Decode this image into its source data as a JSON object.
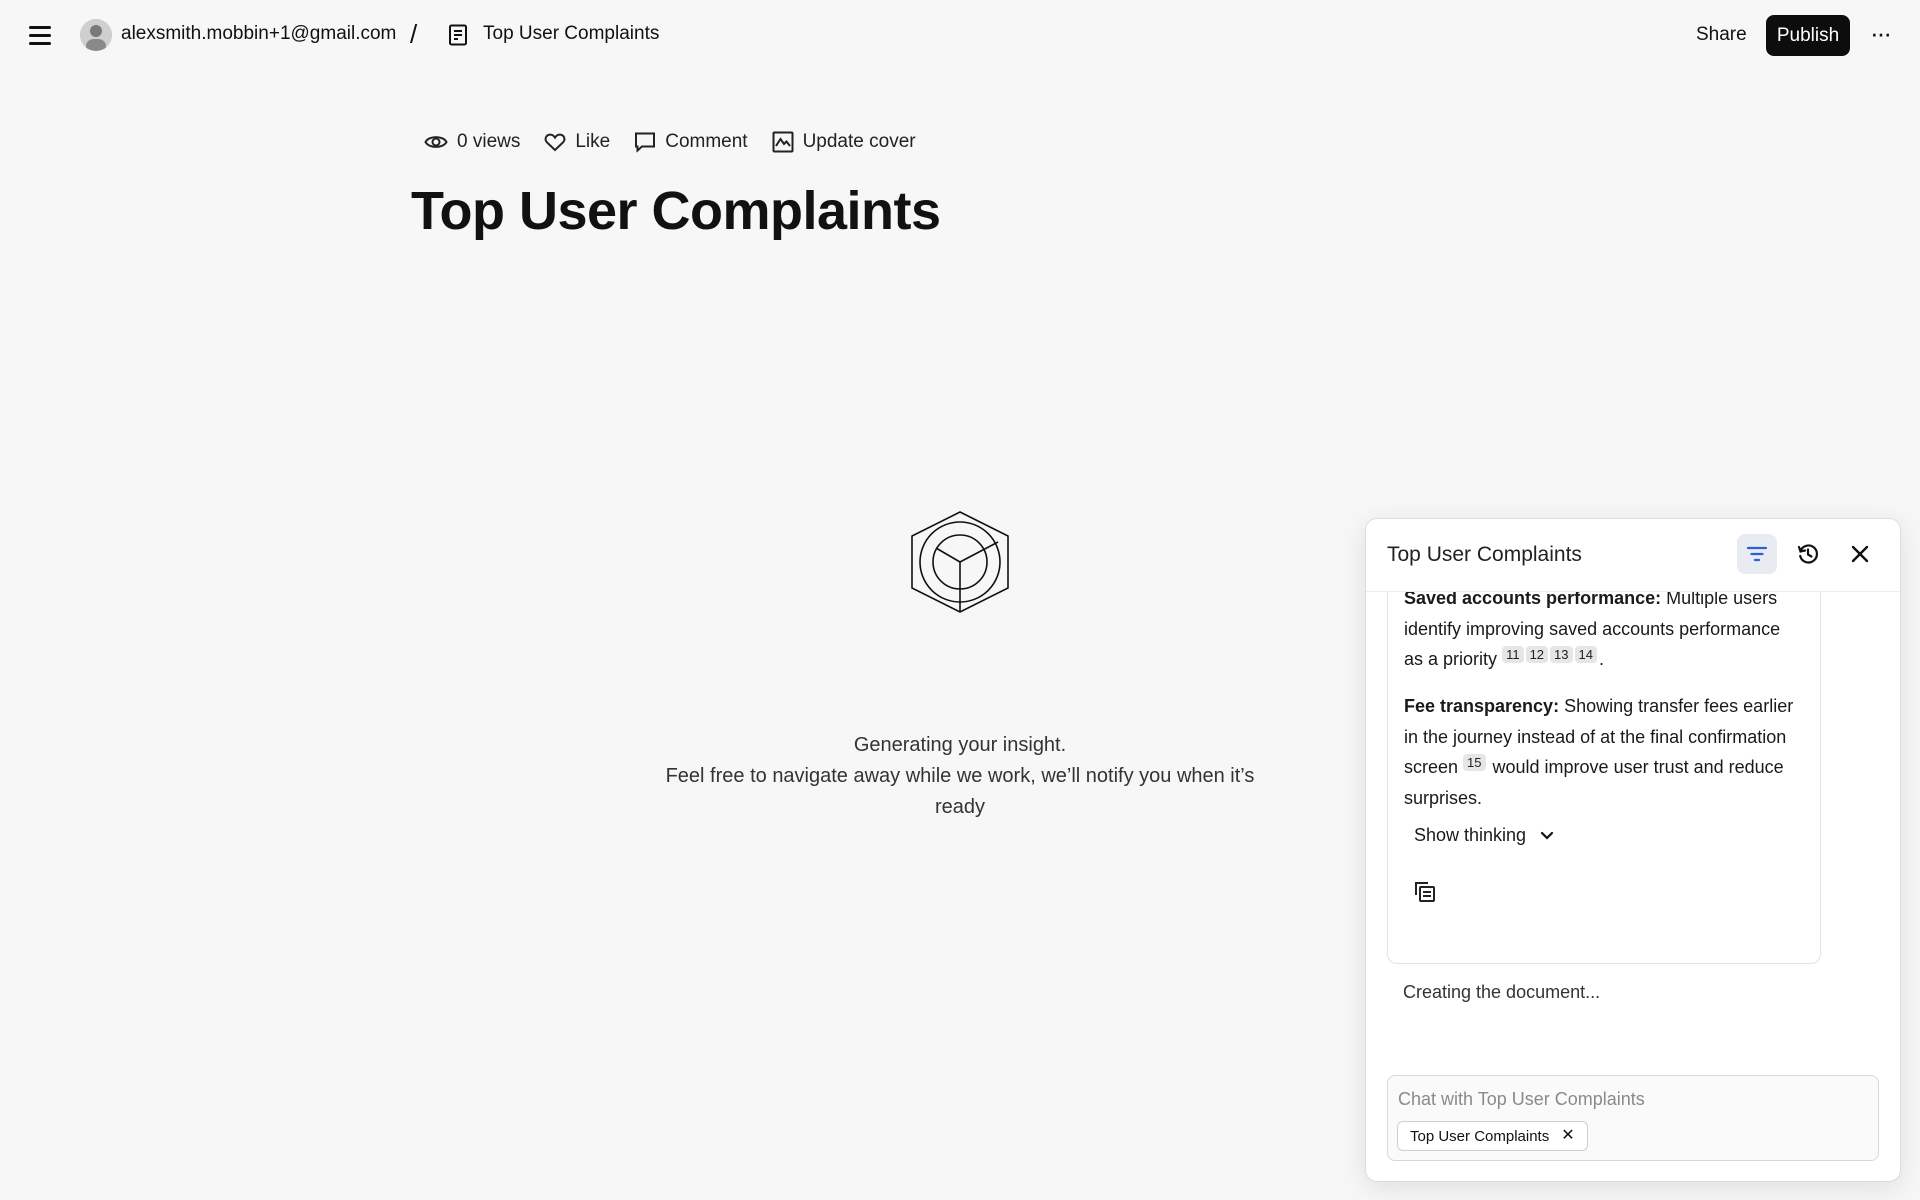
{
  "topbar": {
    "account_email": "alexsmith.mobbin+1@gmail.com",
    "separator": "/",
    "breadcrumb_title": "Top User Complaints",
    "share_label": "Share",
    "publish_label": "Publish",
    "more_label": "···"
  },
  "doc_actions": {
    "views_label": "0 views",
    "like_label": "Like",
    "comment_label": "Comment",
    "update_cover_label": "Update cover"
  },
  "page": {
    "title": "Top User Complaints"
  },
  "generating": {
    "line1": "Generating your insight.",
    "line2": "Feel free to navigate away while we work, we’ll notify you when it’s ready"
  },
  "chat": {
    "title": "Top User Complaints",
    "para1": {
      "bold": "Saved accounts performance:",
      "text": " Multiple users identify improving saved accounts performance as a priority",
      "citations": [
        "11",
        "12",
        "13",
        "14"
      ],
      "end": "."
    },
    "para2": {
      "bold": "Fee transparency:",
      "text_before": " Showing transfer fees earlier in the journey instead of at the final confirmation screen",
      "citation": "15",
      "text_after": " would improve user trust and reduce surprises."
    },
    "show_thinking_label": "Show thinking",
    "status": "Creating the document...",
    "input_placeholder": "Chat with Top User Complaints",
    "context_chip": "Top User Complaints",
    "chip_remove": "✕"
  },
  "icons": {
    "menu": "hamburger-menu-icon",
    "doc": "document-icon",
    "views": "eye-icon",
    "like": "heart-icon",
    "comment": "comment-icon",
    "cover": "image-icon",
    "filter": "filter-icon",
    "history": "history-icon",
    "close": "close-icon",
    "chevron": "chevron-down-icon",
    "copy": "copy-icon"
  },
  "colors": {
    "publish_bg": "#0d0d0d",
    "filter_accent": "#2f5fd7",
    "page_bg": "#f7f7f7"
  }
}
